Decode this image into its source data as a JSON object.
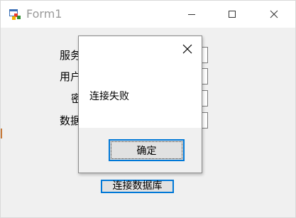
{
  "window": {
    "title": "Form1"
  },
  "form": {
    "labels": {
      "server": "服务",
      "user": "用户",
      "password": "密",
      "database": "数据"
    },
    "connect_button": "连接数据库"
  },
  "dialog": {
    "message": "连接失败",
    "ok_button": "确定"
  },
  "colors": {
    "accent": "#0078d7",
    "background": "#f0f0f0"
  },
  "icons": [
    "app-icon",
    "minimize-icon",
    "maximize-icon",
    "close-icon"
  ]
}
